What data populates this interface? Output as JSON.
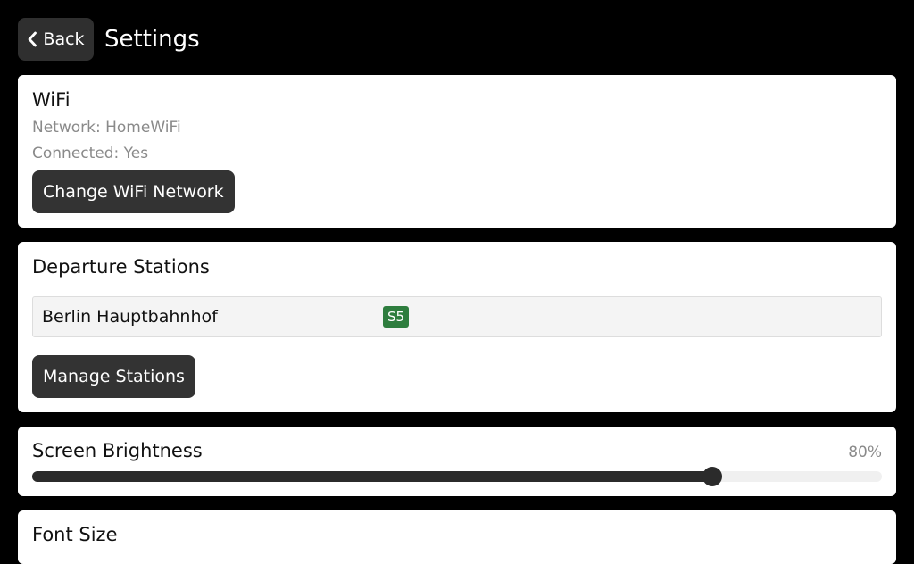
{
  "header": {
    "back_label": "Back",
    "title": "Settings",
    "back_icon": "chevron-left-icon"
  },
  "wifi": {
    "title": "WiFi",
    "network_line": "Network: HomeWiFi",
    "connected_line": "Connected: Yes",
    "change_button": "Change WiFi Network"
  },
  "stations": {
    "title": "Departure Stations",
    "items": [
      {
        "name": "Berlin Hauptbahnhof",
        "lines": [
          "S5"
        ]
      }
    ],
    "manage_button": "Manage Stations",
    "badge_color": "#2e7d3e"
  },
  "brightness": {
    "title": "Screen Brightness",
    "value_label": "80%",
    "value_fraction": 0.8
  },
  "font_size": {
    "title": "Font Size"
  },
  "colors": {
    "background": "#000000",
    "card": "#ffffff",
    "button": "#333333",
    "secondary_text": "#8a8a8a"
  }
}
